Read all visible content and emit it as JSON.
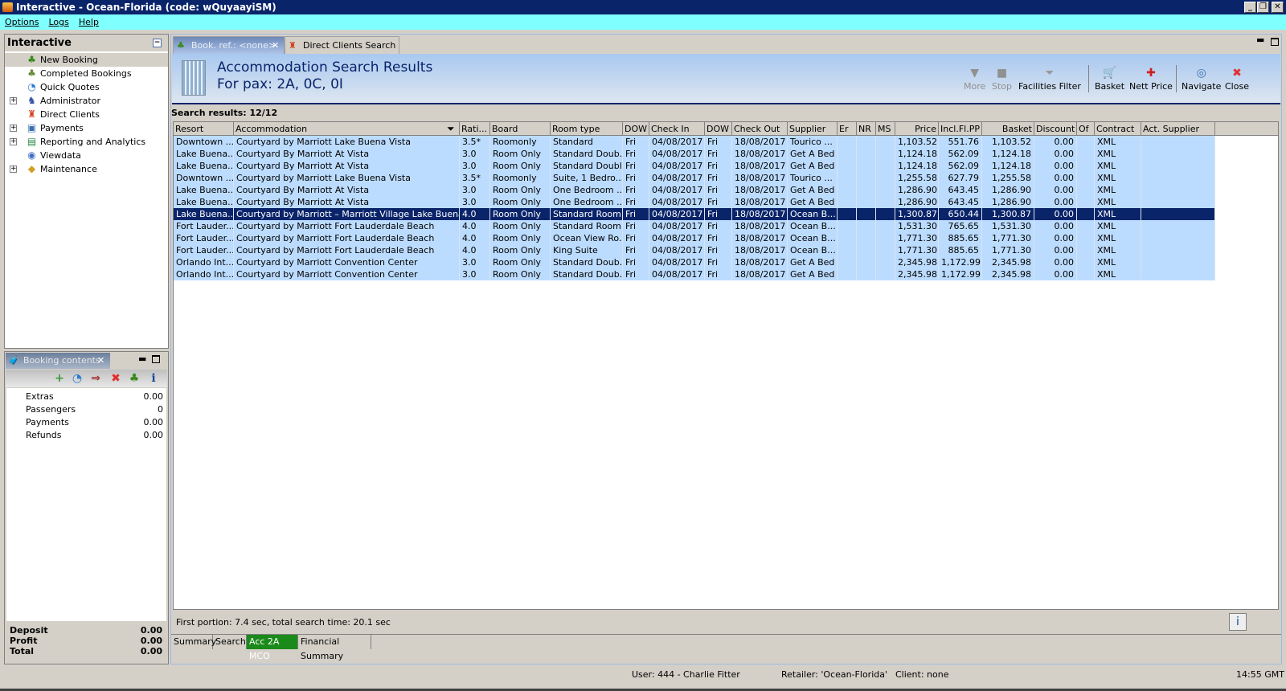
{
  "window": {
    "title": "Interactive - Ocean-Florida (code: wQuyaayiSM)",
    "minimize": "_",
    "maximize": "❐",
    "close": "✕"
  },
  "menu": [
    "Options",
    "Logs",
    "Help"
  ],
  "nav": {
    "title": "Interactive",
    "items": [
      {
        "label": "New Booking",
        "icon": "palm-tree-icon",
        "expandable": false,
        "selected": true
      },
      {
        "label": "Completed Bookings",
        "icon": "palm-cash-icon",
        "expandable": false
      },
      {
        "label": "Quick Quotes",
        "icon": "clock-icon",
        "expandable": false
      },
      {
        "label": "Administrator",
        "icon": "person-icon",
        "expandable": true
      },
      {
        "label": "Direct Clients",
        "icon": "client-icon",
        "expandable": false
      },
      {
        "label": "Payments",
        "icon": "payments-icon",
        "expandable": true
      },
      {
        "label": "Reporting and Analytics",
        "icon": "report-icon",
        "expandable": true
      },
      {
        "label": "Viewdata",
        "icon": "globe-icon",
        "expandable": false
      },
      {
        "label": "Maintenance",
        "icon": "maintenance-icon",
        "expandable": true
      }
    ]
  },
  "booking_contents": {
    "tab": "Booking contents",
    "toolbar": [
      "add-icon",
      "refresh-icon",
      "basket-transfer-icon",
      "delete-icon",
      "palm-tree-icon",
      "info-icon"
    ],
    "rows": [
      {
        "label": "Extras",
        "value": "0.00"
      },
      {
        "label": "Passengers",
        "value": "0"
      },
      {
        "label": "Payments",
        "value": "0.00"
      },
      {
        "label": "Refunds",
        "value": "0.00"
      }
    ],
    "totals": [
      {
        "label": "Deposit",
        "value": "0.00"
      },
      {
        "label": "Profit",
        "value": "0.00"
      },
      {
        "label": "Total",
        "value": "0.00"
      }
    ]
  },
  "tabs": [
    {
      "label": "Book. ref.: <none>",
      "active": true
    },
    {
      "label": "Direct Clients Search",
      "active": false
    }
  ],
  "header": {
    "title": "Accommodation Search Results",
    "subtitle": "For pax: 2A, 0C, 0I"
  },
  "actions": [
    {
      "label": "More",
      "enabled": false
    },
    {
      "label": "Stop",
      "enabled": false
    },
    {
      "label": "Facilities Filter",
      "enabled": true
    },
    {
      "label": "Basket",
      "enabled": true
    },
    {
      "label": "Nett Price",
      "enabled": true
    },
    {
      "label": "Navigate",
      "enabled": true
    },
    {
      "label": "Close",
      "enabled": true
    }
  ],
  "results_label": "Search results: 12/12",
  "columns": [
    "Resort",
    "Accommodation",
    "Rati...",
    "Board",
    "Room type",
    "DOW",
    "Check In",
    "DOW",
    "Check Out",
    "Supplier",
    "Er",
    "NR",
    "MS",
    "Price",
    "Incl.Fl.PP",
    "Basket",
    "Discount",
    "Of",
    "Contract",
    "Act. Supplier"
  ],
  "rows": [
    [
      "Downtown ...",
      "Courtyard by Marriott Lake Buena Vista",
      "3.5*",
      "Roomonly",
      "Standard",
      "Fri",
      "04/08/2017",
      "Fri",
      "18/08/2017",
      "Tourico ...",
      "",
      "",
      "",
      "1,103.52",
      "551.76",
      "1,103.52",
      "0.00",
      "",
      "XML",
      ""
    ],
    [
      "Lake Buena...",
      "Courtyard By Marriott At Vista",
      "3.0",
      "Room Only",
      "Standard Doub...",
      "Fri",
      "04/08/2017",
      "Fri",
      "18/08/2017",
      "Get A Bed",
      "",
      "",
      "",
      "1,124.18",
      "562.09",
      "1,124.18",
      "0.00",
      "",
      "XML",
      ""
    ],
    [
      "Lake Buena...",
      "Courtyard By Marriott At Vista",
      "3.0",
      "Room Only",
      "Standard Double",
      "Fri",
      "04/08/2017",
      "Fri",
      "18/08/2017",
      "Get A Bed",
      "",
      "",
      "",
      "1,124.18",
      "562.09",
      "1,124.18",
      "0.00",
      "",
      "XML",
      ""
    ],
    [
      "Downtown ...",
      "Courtyard by Marriott Lake Buena Vista",
      "3.5*",
      "Roomonly",
      "Suite, 1 Bedro...",
      "Fri",
      "04/08/2017",
      "Fri",
      "18/08/2017",
      "Tourico ...",
      "",
      "",
      "",
      "1,255.58",
      "627.79",
      "1,255.58",
      "0.00",
      "",
      "XML",
      ""
    ],
    [
      "Lake Buena...",
      "Courtyard By Marriott At Vista",
      "3.0",
      "Room Only",
      "One Bedroom ...",
      "Fri",
      "04/08/2017",
      "Fri",
      "18/08/2017",
      "Get A Bed",
      "",
      "",
      "",
      "1,286.90",
      "643.45",
      "1,286.90",
      "0.00",
      "",
      "XML",
      ""
    ],
    [
      "Lake Buena...",
      "Courtyard By Marriott At Vista",
      "3.0",
      "Room Only",
      "One Bedroom ...",
      "Fri",
      "04/08/2017",
      "Fri",
      "18/08/2017",
      "Get A Bed",
      "",
      "",
      "",
      "1,286.90",
      "643.45",
      "1,286.90",
      "0.00",
      "",
      "XML",
      ""
    ],
    [
      "Lake Buena...",
      "Courtyard by Marriott – Marriott Village Lake Buena Vista",
      "4.0",
      "Room Only",
      "Standard Room",
      "Fri",
      "04/08/2017",
      "Fri",
      "18/08/2017",
      "Ocean B...",
      "",
      "",
      "",
      "1,300.87",
      "650.44",
      "1,300.87",
      "0.00",
      "",
      "XML",
      ""
    ],
    [
      "Fort Lauder...",
      "Courtyard by Marriott Fort Lauderdale Beach",
      "4.0",
      "Room Only",
      "Standard Room",
      "Fri",
      "04/08/2017",
      "Fri",
      "18/08/2017",
      "Ocean B...",
      "",
      "",
      "",
      "1,531.30",
      "765.65",
      "1,531.30",
      "0.00",
      "",
      "XML",
      ""
    ],
    [
      "Fort Lauder...",
      "Courtyard by Marriott Fort Lauderdale Beach",
      "4.0",
      "Room Only",
      "Ocean View Ro...",
      "Fri",
      "04/08/2017",
      "Fri",
      "18/08/2017",
      "Ocean B...",
      "",
      "",
      "",
      "1,771.30",
      "885.65",
      "1,771.30",
      "0.00",
      "",
      "XML",
      ""
    ],
    [
      "Fort Lauder...",
      "Courtyard by Marriott Fort Lauderdale Beach",
      "4.0",
      "Room Only",
      "King Suite",
      "Fri",
      "04/08/2017",
      "Fri",
      "18/08/2017",
      "Ocean B...",
      "",
      "",
      "",
      "1,771.30",
      "885.65",
      "1,771.30",
      "0.00",
      "",
      "XML",
      ""
    ],
    [
      "Orlando Int...",
      "Courtyard by Marriott Convention Center",
      "3.0",
      "Room Only",
      "Standard Doub...",
      "Fri",
      "04/08/2017",
      "Fri",
      "18/08/2017",
      "Get A Bed",
      "",
      "",
      "",
      "2,345.98",
      "1,172.99",
      "2,345.98",
      "0.00",
      "",
      "XML",
      ""
    ],
    [
      "Orlando Int...",
      "Courtyard by Marriott Convention Center",
      "3.0",
      "Room Only",
      "Standard Doub...",
      "Fri",
      "04/08/2017",
      "Fri",
      "18/08/2017",
      "Get A Bed",
      "",
      "",
      "",
      "2,345.98",
      "1,172.99",
      "2,345.98",
      "0.00",
      "",
      "XML",
      ""
    ]
  ],
  "selected_row": 6,
  "search_status": "First portion: 7.4 sec, total search time: 20.1 sec",
  "info_button": "i",
  "bottom_tabs": [
    {
      "label": "Summary"
    },
    {
      "label": "Search"
    },
    {
      "label": "Acc 2A MCO",
      "active": true
    },
    {
      "label": "Financial Summary"
    }
  ],
  "statusbar": {
    "user": "User: 444 - Charlie Fitter",
    "retailer": "Retailer: 'Ocean-Florida'",
    "client": "Client: none",
    "time": "14:55 GMT"
  },
  "colors": {
    "title_bar": "#0a246a",
    "menu_bar": "#80ffff",
    "row_bg": "#bcdcff",
    "selected_row": "#0a246a",
    "active_bottom_tab": "#1a8a1a"
  }
}
